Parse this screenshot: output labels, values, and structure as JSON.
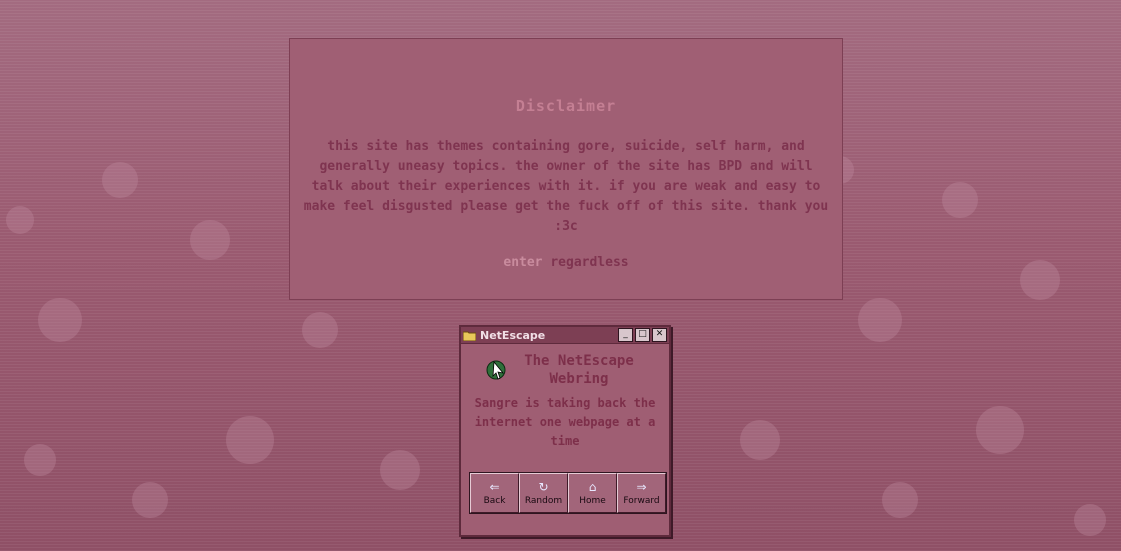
{
  "disclaimer": {
    "title": "Disclaimer",
    "body": "this site has themes containing gore, suicide, self harm, and generally uneasy topics. the owner of the site has BPD and will talk about their experiences with it. if you are weak and easy to make feel disgusted please get the fuck off of this site. thank you :3c",
    "enter_link": "enter",
    "regardless": "regardless"
  },
  "webring_window": {
    "title": "NetEscape",
    "heading": "The NetEscape Webring",
    "member": "Sangre",
    "tagline": "is taking back the internet one webpage at a time",
    "window_buttons": {
      "minimize": "_",
      "maximize": "□",
      "close": "✕"
    },
    "nav": [
      {
        "label": "Back",
        "icon": "back-arrow-icon",
        "glyph": "⇐"
      },
      {
        "label": "Random",
        "icon": "random-refresh-icon",
        "glyph": "↻"
      },
      {
        "label": "Home",
        "icon": "home-icon",
        "glyph": "⌂"
      },
      {
        "label": "Forward",
        "icon": "forward-arrow-icon",
        "glyph": "⇒"
      }
    ]
  },
  "colors": {
    "accent": "#7d3f54",
    "background": "#9a5a70",
    "text": "#7f3450"
  }
}
